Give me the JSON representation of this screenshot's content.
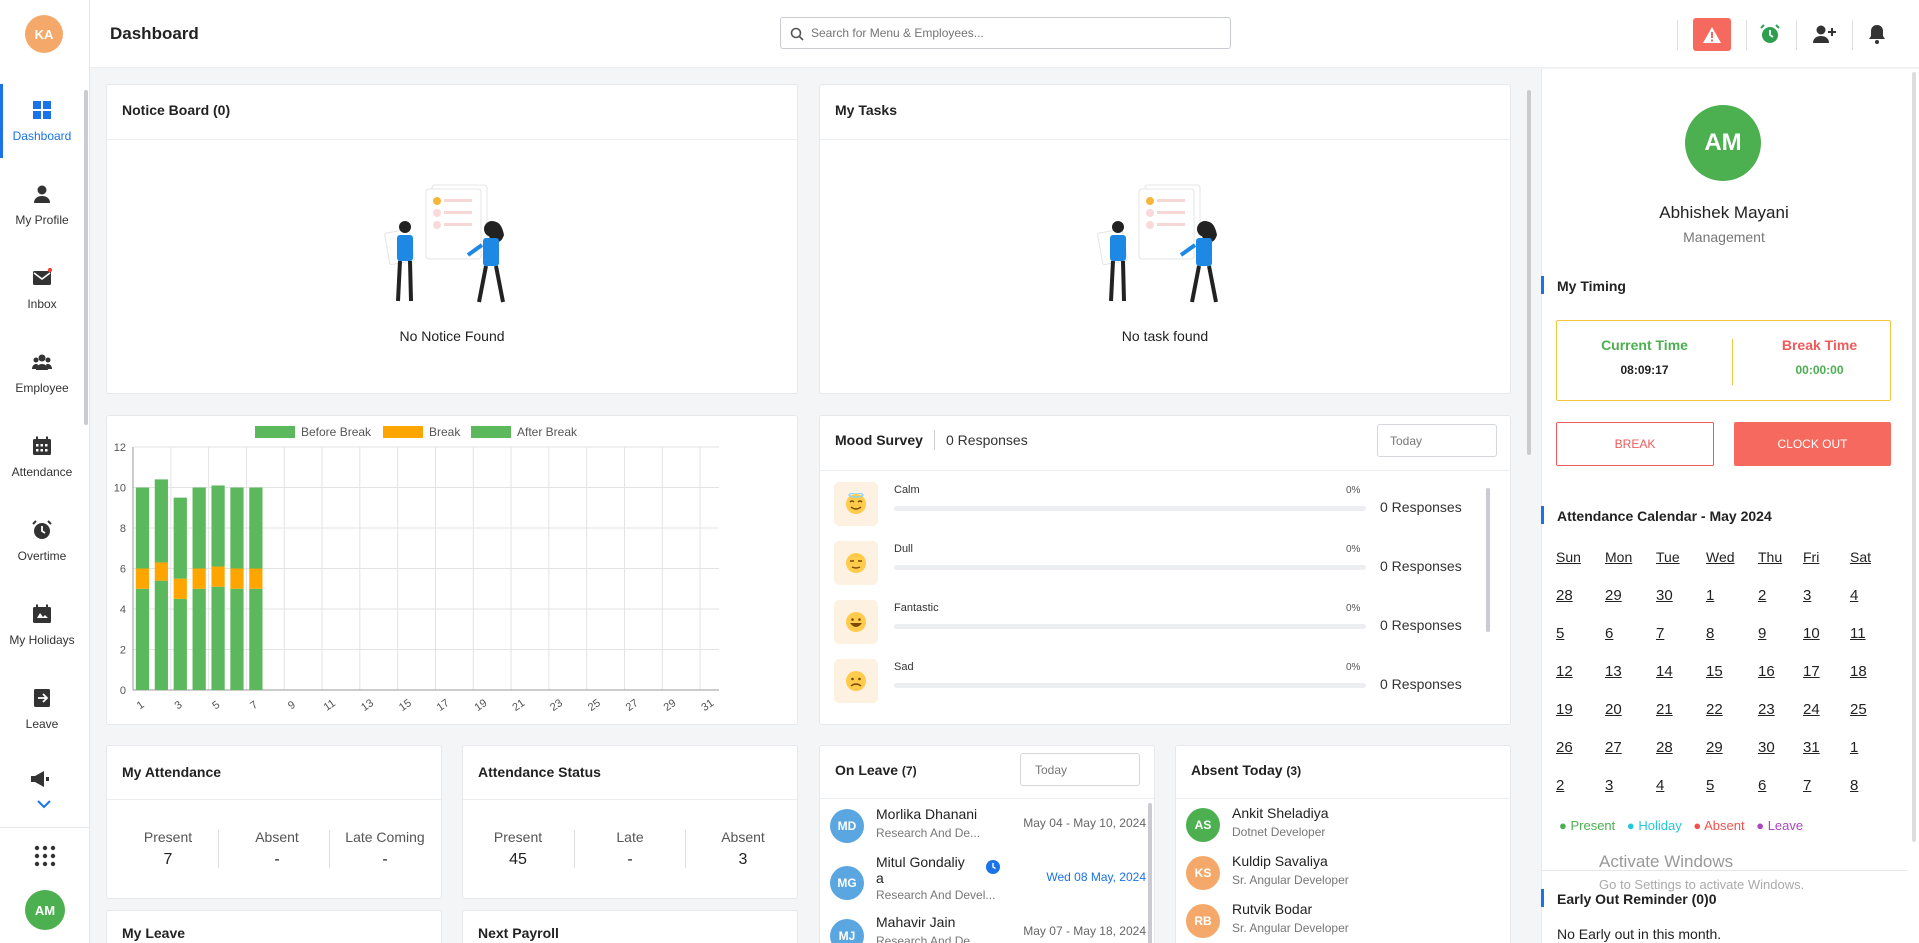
{
  "user": {
    "initials": "KA"
  },
  "sidebar": {
    "items": [
      {
        "label": "Dashboard",
        "icon": "grid-icon"
      },
      {
        "label": "My Profile",
        "icon": "person-icon"
      },
      {
        "label": "Inbox",
        "icon": "mail-icon"
      },
      {
        "label": "Employee",
        "icon": "people-icon"
      },
      {
        "label": "Attendance",
        "icon": "calendar-icon"
      },
      {
        "label": "Overtime",
        "icon": "alarm-icon"
      },
      {
        "label": "My Holidays",
        "icon": "holiday-calendar-icon"
      },
      {
        "label": "Leave",
        "icon": "exit-icon"
      }
    ],
    "bottom_avatar": "AM"
  },
  "header": {
    "title": "Dashboard",
    "search_placeholder": "Search for Menu & Employees..."
  },
  "notice_board": {
    "title": "Notice Board (0)",
    "empty": "No Notice Found"
  },
  "my_tasks": {
    "title": "My Tasks",
    "empty": "No task found"
  },
  "chart_data": {
    "type": "bar",
    "stacked": true,
    "legend": [
      "Before Break",
      "Break",
      "After Break"
    ],
    "legend_position": "top",
    "colors": {
      "Before Break": "#5cb85c",
      "Break": "#ffa500",
      "After Break": "#5cb85c"
    },
    "x": [
      1,
      2,
      3,
      4,
      5,
      6,
      7,
      8,
      9,
      10,
      11,
      12,
      13,
      14,
      15,
      16,
      17,
      18,
      19,
      20,
      21,
      22,
      23,
      24,
      25,
      26,
      27,
      28,
      29,
      30,
      31
    ],
    "x_tick_labels": [
      "1",
      "3",
      "5",
      "7",
      "9",
      "11",
      "13",
      "15",
      "17",
      "19",
      "21",
      "23",
      "25",
      "27",
      "29",
      "31"
    ],
    "ylim": [
      0,
      12
    ],
    "y_ticks": [
      0,
      2,
      4,
      6,
      8,
      10,
      12
    ],
    "series": [
      {
        "name": "Before Break",
        "values": [
          5,
          5.4,
          4.5,
          5,
          5.1,
          5,
          5
        ]
      },
      {
        "name": "Break",
        "values": [
          1,
          0.9,
          1,
          1,
          1,
          1,
          1
        ]
      },
      {
        "name": "After Break",
        "values": [
          4,
          4.1,
          4,
          4,
          4,
          4,
          4
        ]
      }
    ],
    "grid": true
  },
  "mood": {
    "title": "Mood Survey",
    "responses": "0 Responses",
    "filter": "Today",
    "items": [
      {
        "label": "Calm",
        "pct": "0%",
        "count": "0 Responses",
        "icon": "calm-emoji-icon"
      },
      {
        "label": "Dull",
        "pct": "0%",
        "count": "0 Responses",
        "icon": "dull-emoji-icon"
      },
      {
        "label": "Fantastic",
        "pct": "0%",
        "count": "0 Responses",
        "icon": "fantastic-emoji-icon"
      },
      {
        "label": "Sad",
        "pct": "0%",
        "count": "0 Responses",
        "icon": "sad-emoji-icon"
      }
    ]
  },
  "my_attendance": {
    "title": "My Attendance",
    "stats": [
      {
        "label": "Present",
        "value": "7"
      },
      {
        "label": "Absent",
        "value": "-"
      },
      {
        "label": "Late Coming",
        "value": "-"
      }
    ]
  },
  "attendance_status": {
    "title": "Attendance Status",
    "stats": [
      {
        "label": "Present",
        "value": "45"
      },
      {
        "label": "Late",
        "value": "-"
      },
      {
        "label": "Absent",
        "value": "3"
      }
    ]
  },
  "on_leave": {
    "title": "On Leave",
    "count": "(7)",
    "filter": "Today",
    "people": [
      {
        "initials": "MD",
        "name": "Morlika Dhanani",
        "dept": "Research And De...",
        "date": "May 04 - May 10, 2024"
      },
      {
        "initials": "MG",
        "name": "Mitul Gondaliy",
        "name2": "a",
        "dept": "Research And Devel...",
        "date": "Wed 08 May, 2024"
      },
      {
        "initials": "MJ",
        "name": "Mahavir Jain",
        "dept": "Research And De...",
        "date": "May 07 - May 18, 2024"
      }
    ]
  },
  "absent_today": {
    "title": "Absent Today",
    "count": "(3)",
    "people": [
      {
        "initials": "AS",
        "name": "Ankit Sheladiya",
        "role": "Dotnet Developer"
      },
      {
        "initials": "KS",
        "name": "Kuldip Savaliya",
        "role": "Sr. Angular Developer"
      },
      {
        "initials": "RB",
        "name": "Rutvik Bodar",
        "role": "Sr. Angular Developer"
      }
    ]
  },
  "my_leave": {
    "title": "My Leave"
  },
  "next_payroll": {
    "title": "Next Payroll"
  },
  "profile": {
    "initials": "AM",
    "name": "Abhishek Mayani",
    "dept": "Management"
  },
  "timing": {
    "title": "My Timing",
    "current_label": "Current Time",
    "current_value": "08:09:17",
    "break_label": "Break Time",
    "break_value": "00:00:00",
    "break_btn": "BREAK",
    "clockout_btn": "CLOCK OUT"
  },
  "calendar": {
    "title": "Attendance Calendar - May 2024",
    "days": [
      "Sun",
      "Mon",
      "Tue",
      "Wed",
      "Thu",
      "Fri",
      "Sat"
    ],
    "weeks": [
      [
        "28",
        "29",
        "30",
        "1",
        "2",
        "3",
        "4"
      ],
      [
        "5",
        "6",
        "7",
        "8",
        "9",
        "10",
        "11"
      ],
      [
        "12",
        "13",
        "14",
        "15",
        "16",
        "17",
        "18"
      ],
      [
        "19",
        "20",
        "21",
        "22",
        "23",
        "24",
        "25"
      ],
      [
        "26",
        "27",
        "28",
        "29",
        "30",
        "31",
        "1"
      ],
      [
        "2",
        "3",
        "4",
        "5",
        "6",
        "7",
        "8"
      ]
    ],
    "legend": [
      {
        "label": "Present",
        "color": "#4caf50"
      },
      {
        "label": "Holiday",
        "color": "#26c6da"
      },
      {
        "label": "Absent",
        "color": "#ef5350"
      },
      {
        "label": "Leave",
        "color": "#ab47bc"
      }
    ]
  },
  "early_out": {
    "title": "Early Out Reminder (0)0",
    "empty": "No Early out in this month."
  },
  "watermark": {
    "line1": "Activate Windows",
    "line2": "Go to Settings to activate Windows."
  }
}
